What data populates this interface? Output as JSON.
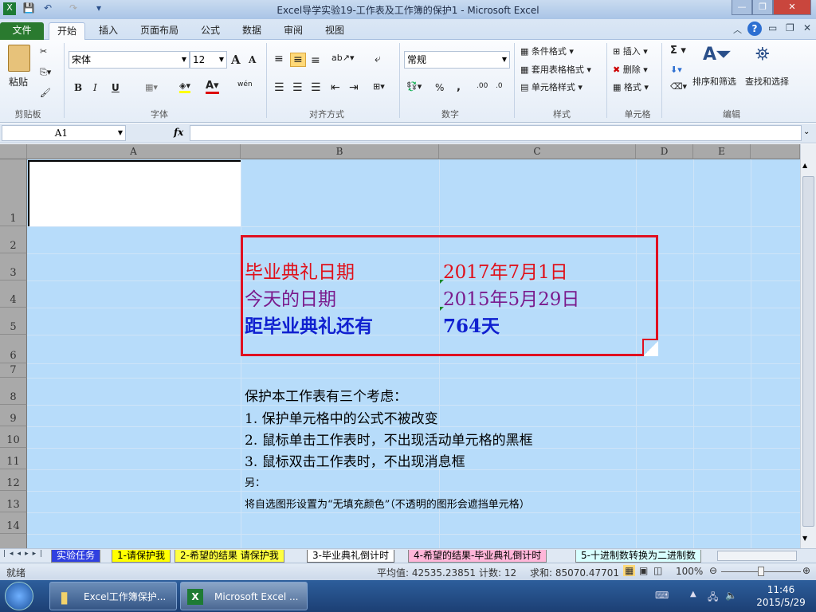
{
  "title": "Excel导学实验19-工作表及工作簿的保护1 - Microsoft Excel",
  "ribbon_tabs": [
    "文件",
    "开始",
    "插入",
    "页面布局",
    "公式",
    "数据",
    "审阅",
    "视图"
  ],
  "clipboard": {
    "paste": "粘贴",
    "group": "剪贴板"
  },
  "font": {
    "name": "宋体",
    "size": "12",
    "group": "字体",
    "bold": "B",
    "italic": "I",
    "underline": "U",
    "grow": "A",
    "shrink": "A",
    "phonetic": "wén"
  },
  "alignment": {
    "group": "对齐方式"
  },
  "number": {
    "format": "常规",
    "group": "数字",
    "percent": "%",
    "comma": ",",
    "inc_decimal": ".00",
    "dec_decimal": ".0"
  },
  "styles": {
    "conditional": "条件格式",
    "table": "套用表格格式",
    "cell": "单元格样式",
    "group": "样式"
  },
  "cells": {
    "insert": "插入",
    "delete": "删除",
    "format": "格式",
    "group": "单元格"
  },
  "editing": {
    "sum": "Σ",
    "sort": "排序和筛选",
    "find": "查找和选择",
    "group": "编辑"
  },
  "formula_bar": {
    "name_box": "A1",
    "fx": "fx",
    "value": ""
  },
  "columns": [
    "A",
    "B",
    "C",
    "D",
    "E"
  ],
  "rows": [
    "1",
    "2",
    "3",
    "4",
    "5",
    "6",
    "7",
    "8",
    "9",
    "10",
    "11",
    "12",
    "13",
    "14"
  ],
  "content": {
    "label1": "毕业典礼日期",
    "value1": "2017年7月1日",
    "label2": "今天的日期",
    "value2": "2015年5月29日",
    "label3": "距毕业典礼还有",
    "value3": "764天",
    "note_title": "保护本工作表有三个考虑：",
    "note1": "1. 保护单元格中的公式不被改变",
    "note2": "2. 鼠标单击工作表时，不出现活动单元格的黑框",
    "note3": "3. 鼠标双击工作表时，不出现消息框",
    "note4": "另：",
    "note5": "将自选图形设置为“无填充颜色”（不透明的图形会遮挡单元格）"
  },
  "colors": {
    "label1": "#e0101a",
    "label2": "#7a1a8c",
    "label3": "#1020d0",
    "shape_border": "#e01020",
    "sheet_fill": "#b7dcfa"
  },
  "sheet_tabs": [
    {
      "label": "实验任务",
      "bg": "#3040e0",
      "fg": "#ffffff"
    },
    {
      "label": "1-请保护我",
      "bg": "#ffff00",
      "fg": "#000000"
    },
    {
      "label": "2-希望的结果 请保护我",
      "bg": "#ffff40",
      "fg": "#000000"
    },
    {
      "label": "3-毕业典礼倒计时",
      "bg": "#ffffff",
      "fg": "#000000"
    },
    {
      "label": "4-希望的结果-毕业典礼倒计时",
      "bg": "#ffb6d9",
      "fg": "#000000"
    },
    {
      "label": "5-十进制数转换为二进制数",
      "bg": "#d8ffff",
      "fg": "#000000"
    }
  ],
  "status": {
    "ready": "就绪",
    "average": "平均值: 42535.23851",
    "count": "计数: 12",
    "sum": "求和: 85070.47701",
    "zoom": "100%"
  },
  "taskbar": {
    "item1": "Excel工作簿保护...",
    "item2": "Microsoft Excel ...",
    "time": "11:46",
    "date": "2015/5/29"
  }
}
